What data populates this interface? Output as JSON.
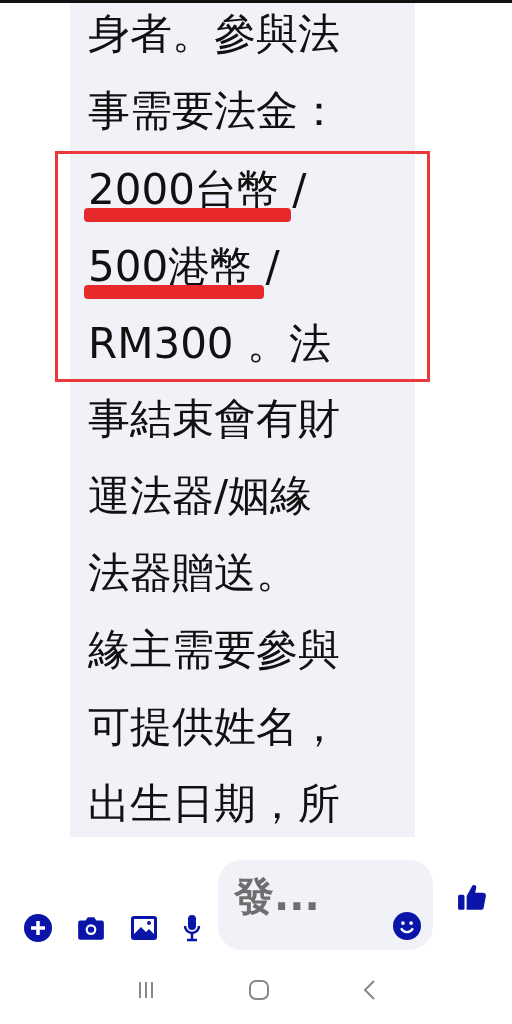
{
  "message": {
    "blocks": [
      {
        "kind": "plain",
        "lines": [
          {
            "text": "身者。參與法",
            "underlined": false
          },
          {
            "text": "事需要法金：",
            "underlined": false
          }
        ]
      },
      {
        "kind": "boxed",
        "lines": [
          {
            "text": "2000台幣",
            "tail": " /",
            "underlined": true
          },
          {
            "text": "500港幣",
            "tail": " /",
            "underlined": true
          },
          {
            "text": "RM300 。法",
            "underlined": false
          }
        ]
      },
      {
        "kind": "plain",
        "lines": [
          {
            "text": "事結束會有財",
            "underlined": false
          },
          {
            "text": "運法器/姻緣",
            "underlined": false
          },
          {
            "text": "法器贈送。",
            "underlined": false
          },
          {
            "text": "緣主需要參與",
            "underlined": false
          },
          {
            "text": "可提供姓名，",
            "underlined": false
          },
          {
            "text": "出生日期，所",
            "underlined": false
          }
        ]
      }
    ]
  },
  "composer": {
    "placeholder": "發..."
  }
}
